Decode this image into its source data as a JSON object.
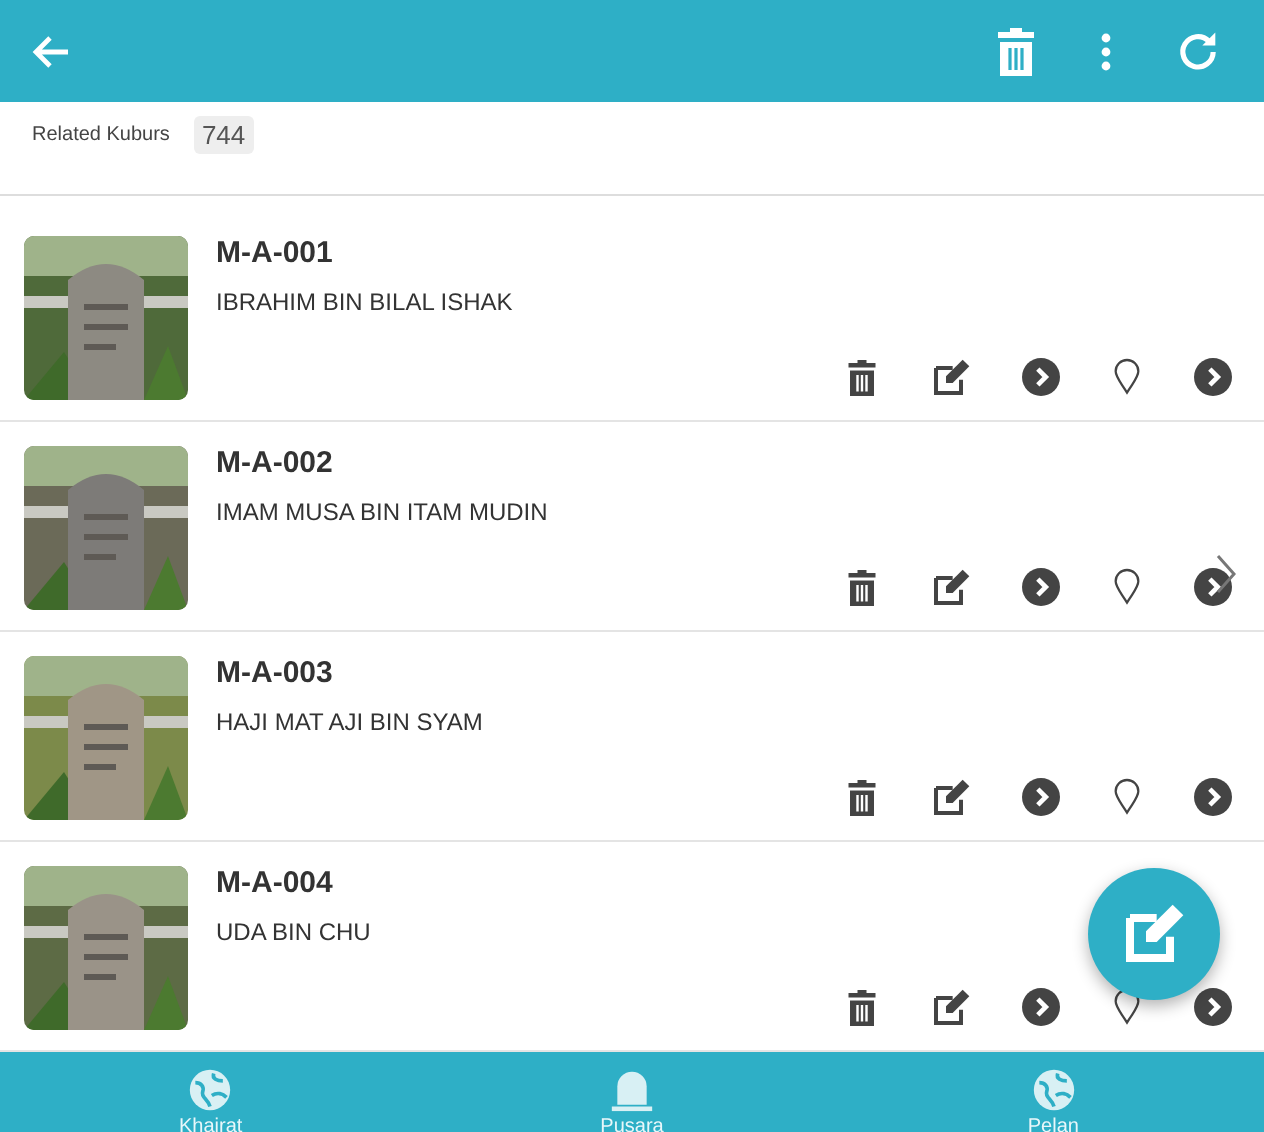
{
  "related": {
    "label": "Related Kuburs",
    "count": "744"
  },
  "items": [
    {
      "code": "M-A-001",
      "name": "IBRAHIM BIN BILAL ISHAK",
      "swipe_hint": false
    },
    {
      "code": "M-A-002",
      "name": "IMAM MUSA BIN ITAM MUDIN",
      "swipe_hint": true
    },
    {
      "code": "M-A-003",
      "name": "HAJI MAT AJI BIN SYAM",
      "swipe_hint": false
    },
    {
      "code": "M-A-004",
      "name": "UDA BIN CHU",
      "swipe_hint": false
    }
  ],
  "nav": [
    {
      "label": "Khairat",
      "kind": "globe"
    },
    {
      "label": "Pusara",
      "kind": "tomb"
    },
    {
      "label": "Pelan",
      "kind": "globe"
    }
  ]
}
